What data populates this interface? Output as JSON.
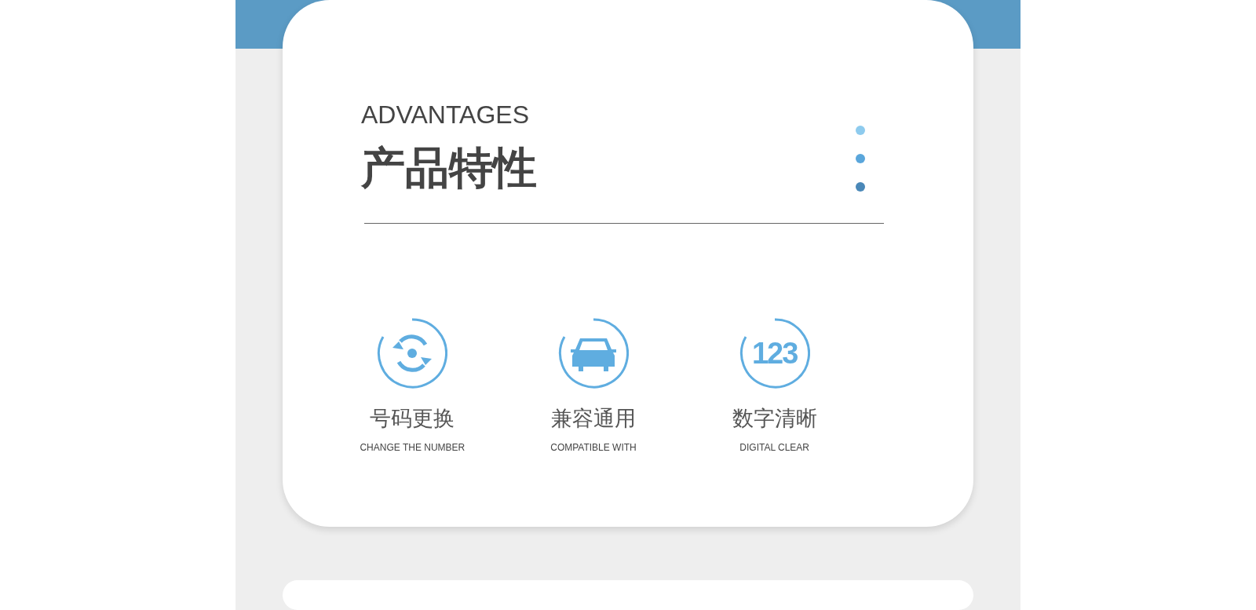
{
  "header": {
    "eyebrow": "ADVANTAGES",
    "title": "产品特性"
  },
  "dots": [
    {
      "color": "#8ecbee"
    },
    {
      "color": "#5aa6db"
    },
    {
      "color": "#4a88b8"
    }
  ],
  "features": [
    {
      "kind": "refresh",
      "title": "号码更换",
      "subtitle": "CHANGE THE NUMBER"
    },
    {
      "kind": "car",
      "title": "兼容通用",
      "subtitle": "COMPATIBLE WITH"
    },
    {
      "kind": "digits",
      "icon_text": "123",
      "title": "数字清晰",
      "subtitle": "DIGITAL CLEAR"
    }
  ]
}
